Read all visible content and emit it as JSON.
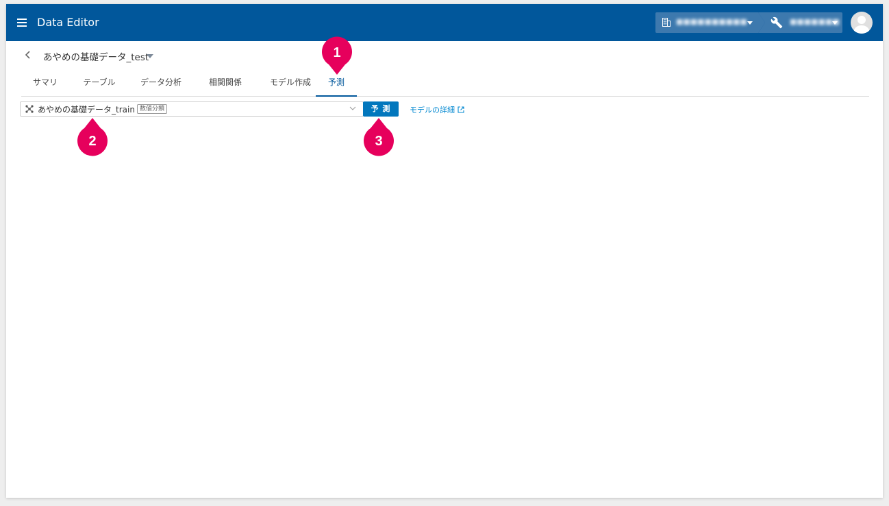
{
  "app": {
    "title": "Data Editor",
    "org_label": "■■■■■■■■■■",
    "project_label": "■■■■■■■"
  },
  "dataset": {
    "title": "あやめの基礎データ_test"
  },
  "tabs": [
    {
      "label": "サマリ"
    },
    {
      "label": "テーブル"
    },
    {
      "label": "データ分析"
    },
    {
      "label": "相関関係"
    },
    {
      "label": "モデル作成"
    },
    {
      "label": "予測"
    }
  ],
  "active_tab": "予測",
  "prediction": {
    "model_name": "あやめの基礎データ_train",
    "model_type": "数値分類",
    "predict_label": "予 測",
    "detail_link": "モデルの詳細"
  },
  "markers": [
    "1",
    "2",
    "3"
  ],
  "colors": {
    "appbar": "#01579b",
    "accent": "#0277bd",
    "link": "#0288d1",
    "marker": "#e6005c"
  },
  "icons": [
    "menu-icon",
    "building-icon",
    "wrench-icon",
    "user-avatar-icon",
    "back-chevron-icon",
    "model-icon",
    "chevron-down-icon",
    "external-link-icon"
  ]
}
